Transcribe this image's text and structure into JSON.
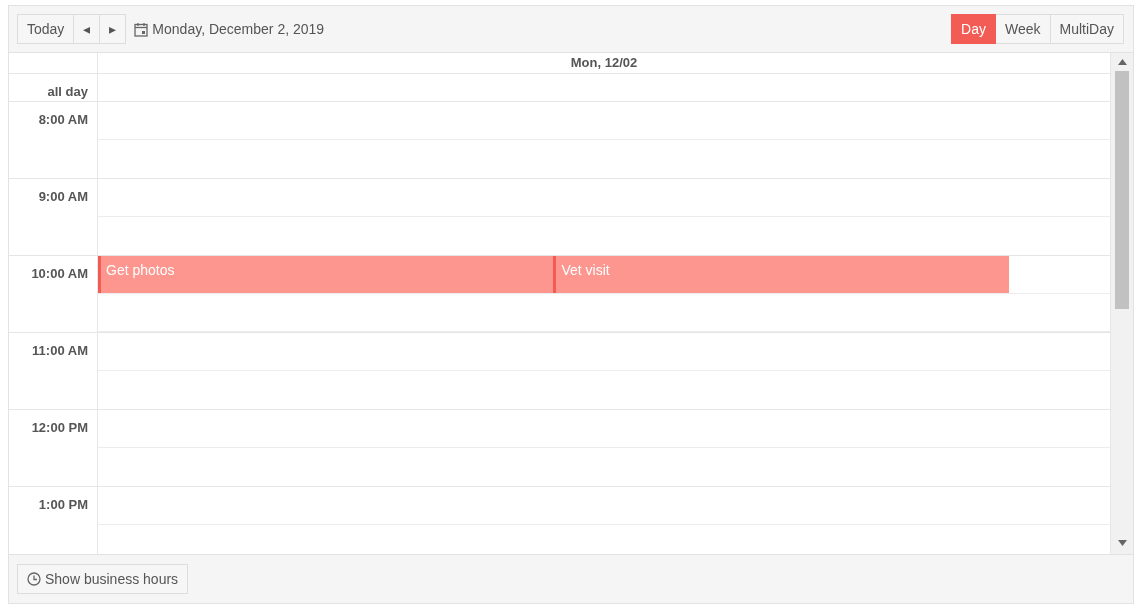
{
  "toolbar": {
    "today": "Today",
    "prev": "◂",
    "next": "▸",
    "date": "Monday, December 2, 2019",
    "views": [
      {
        "label": "Day",
        "selected": true
      },
      {
        "label": "Week",
        "selected": false
      },
      {
        "label": "MultiDay",
        "selected": false
      }
    ]
  },
  "day_header": "Mon, 12/02",
  "all_day_label": "all day",
  "hours": [
    {
      "label": "8:00 AM"
    },
    {
      "label": "9:00 AM"
    },
    {
      "label": "10:00 AM",
      "events": [
        {
          "title": "Get photos"
        },
        {
          "title": "Vet visit"
        }
      ]
    },
    {
      "label": "11:00 AM"
    },
    {
      "label": "12:00 PM"
    },
    {
      "label": "1:00 PM"
    }
  ],
  "footer": {
    "button": "Show business hours"
  }
}
